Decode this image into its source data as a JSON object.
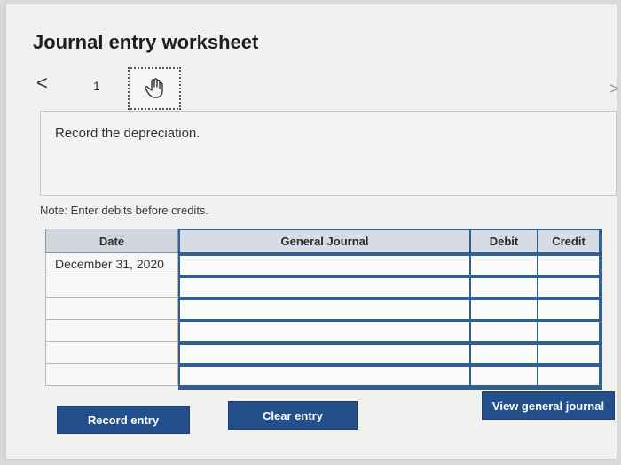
{
  "worksheet": {
    "title": "Journal entry worksheet",
    "nav_prev": "<",
    "nav_next": ">",
    "entry_number": "1",
    "instruction": "Record the depreciation.",
    "note": "Note: Enter debits before credits."
  },
  "table": {
    "headers": {
      "date": "Date",
      "general_journal": "General Journal",
      "debit": "Debit",
      "credit": "Credit"
    },
    "rows": [
      {
        "date": "December 31, 2020",
        "account": "",
        "debit": "",
        "credit": ""
      },
      {
        "date": "",
        "account": "",
        "debit": "",
        "credit": ""
      },
      {
        "date": "",
        "account": "",
        "debit": "",
        "credit": ""
      },
      {
        "date": "",
        "account": "",
        "debit": "",
        "credit": ""
      },
      {
        "date": "",
        "account": "",
        "debit": "",
        "credit": ""
      },
      {
        "date": "",
        "account": "",
        "debit": "",
        "credit": ""
      }
    ]
  },
  "buttons": {
    "record": "Record entry",
    "clear": "Clear entry",
    "view": "View general journal"
  },
  "colors": {
    "button_blue": "#23508a",
    "grid_border": "#2f5f93"
  },
  "icons": {
    "hand": "hand-pointer-icon"
  }
}
